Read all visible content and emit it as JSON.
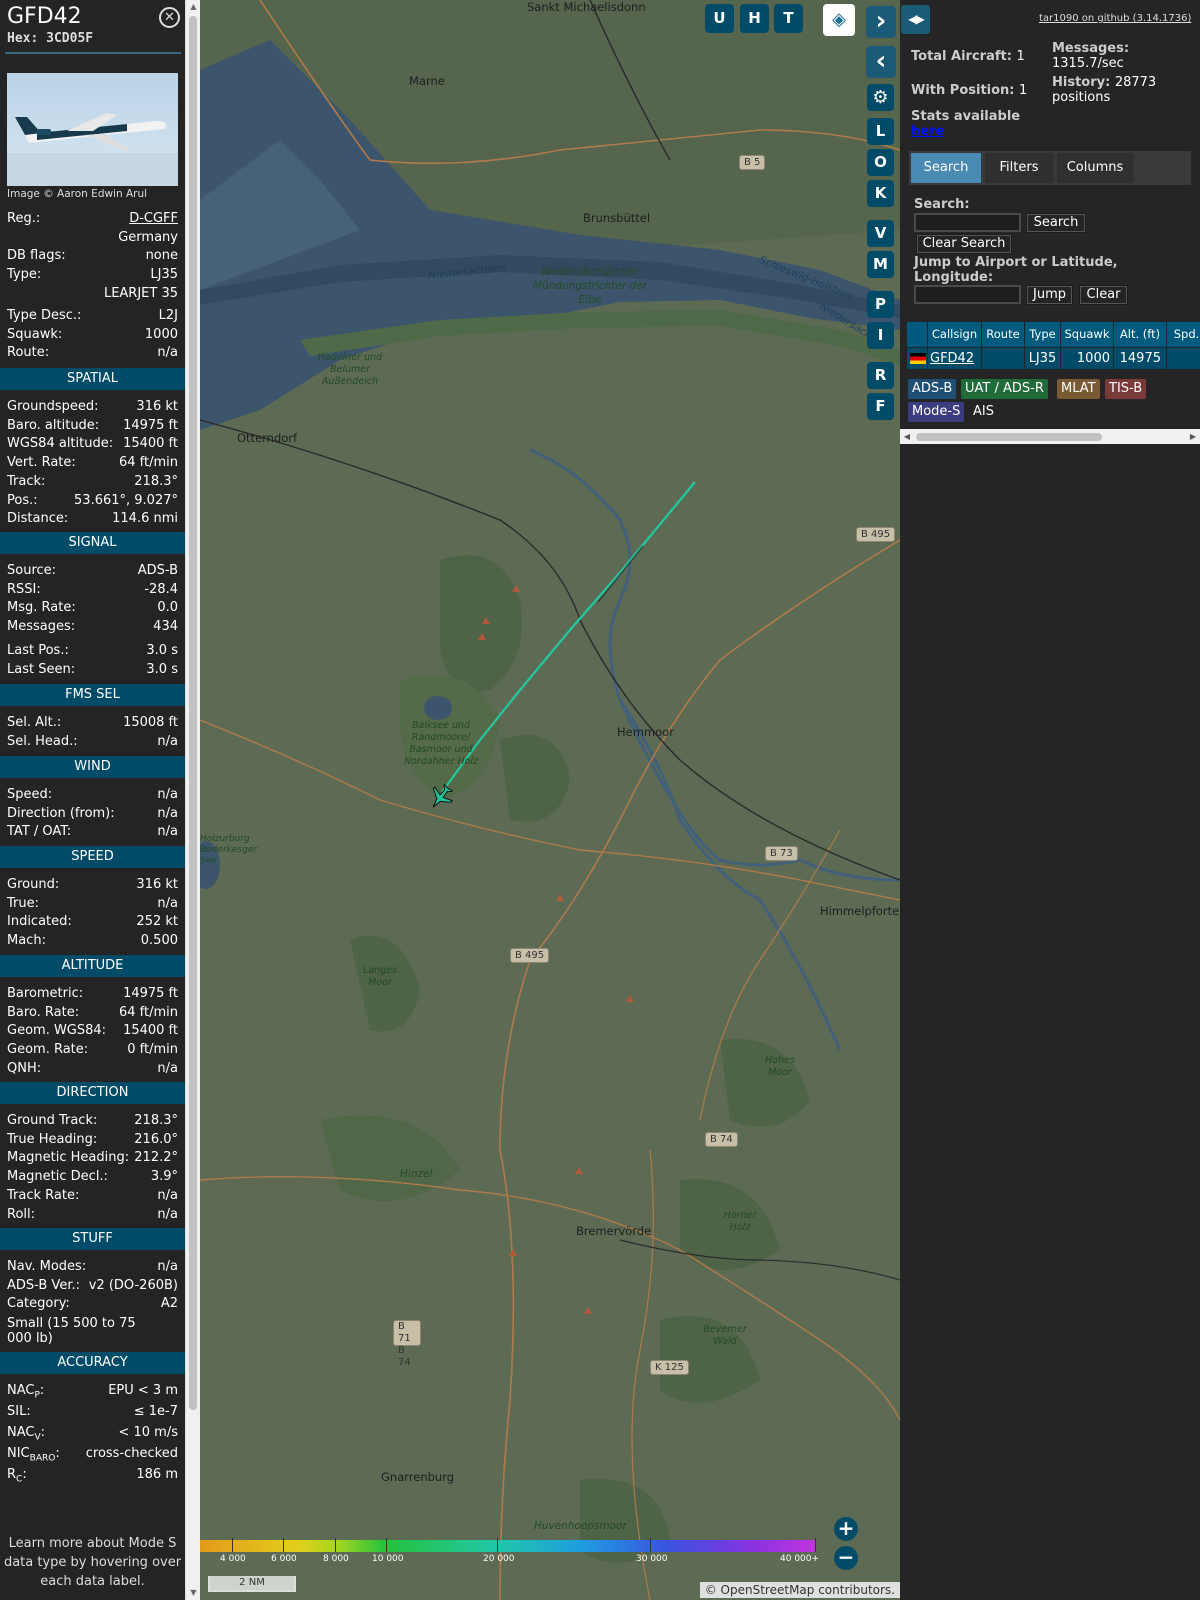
{
  "info": {
    "callsign": "GFD42",
    "hex": "Hex: 3CD05F",
    "close_icon": "close-icon",
    "photo_credit": "Image © Aaron Edwin Arul",
    "top_rows": [
      {
        "label": "Reg.:",
        "value": "D-CGFF",
        "link": true
      },
      {
        "label": "",
        "value": "Germany"
      },
      {
        "label": "DB flags:",
        "value": "none"
      },
      {
        "label": "Type:",
        "value": "LJ35"
      },
      {
        "label": "",
        "value": "LEARJET 35"
      },
      {
        "label": "Type Desc.:",
        "value": "L2J"
      },
      {
        "label": "Squawk:",
        "value": "1000"
      },
      {
        "label": "Route:",
        "value": "n/a"
      }
    ],
    "sections": [
      {
        "title": "SPATIAL",
        "rows": [
          {
            "label": "Groundspeed:",
            "value": "316 kt"
          },
          {
            "label": "Baro. altitude:",
            "value": "14975 ft"
          },
          {
            "label": "WGS84 altitude:",
            "value": "15400 ft"
          },
          {
            "label": "Vert. Rate:",
            "value": "64 ft/min"
          },
          {
            "label": "Track:",
            "value": "218.3°"
          },
          {
            "label": "Pos.:",
            "value": "53.661°, 9.027°"
          },
          {
            "label": "Distance:",
            "value": "114.6 nmi"
          }
        ]
      },
      {
        "title": "SIGNAL",
        "rows": [
          {
            "label": "Source:",
            "value": "ADS-B"
          },
          {
            "label": "RSSI:",
            "value": "-28.4"
          },
          {
            "label": "Msg. Rate:",
            "value": "0.0"
          },
          {
            "label": "Messages:",
            "value": "434"
          },
          {
            "label": "Last Pos.:",
            "value": "3.0 s"
          },
          {
            "label": "Last Seen:",
            "value": "3.0 s"
          }
        ]
      },
      {
        "title": "FMS SEL",
        "rows": [
          {
            "label": "Sel. Alt.:",
            "value": "15008 ft"
          },
          {
            "label": "Sel. Head.:",
            "value": "n/a"
          }
        ]
      },
      {
        "title": "WIND",
        "rows": [
          {
            "label": "Speed:",
            "value": "n/a"
          },
          {
            "label": "Direction (from):",
            "value": "n/a"
          },
          {
            "label": "TAT / OAT:",
            "value": "n/a"
          }
        ]
      },
      {
        "title": "SPEED",
        "rows": [
          {
            "label": "Ground:",
            "value": "316 kt"
          },
          {
            "label": "True:",
            "value": "n/a"
          },
          {
            "label": "Indicated:",
            "value": "252 kt"
          },
          {
            "label": "Mach:",
            "value": "0.500"
          }
        ]
      },
      {
        "title": "ALTITUDE",
        "rows": [
          {
            "label": "Barometric:",
            "value": "14975 ft"
          },
          {
            "label": "Baro. Rate:",
            "value": "64 ft/min"
          },
          {
            "label": "Geom. WGS84:",
            "value": "15400 ft"
          },
          {
            "label": "Geom. Rate:",
            "value": "0 ft/min"
          },
          {
            "label": "QNH:",
            "value": "n/a"
          }
        ]
      },
      {
        "title": "DIRECTION",
        "rows": [
          {
            "label": "Ground Track:",
            "value": "218.3°"
          },
          {
            "label": "True Heading:",
            "value": "216.0°"
          },
          {
            "label": "Magnetic Heading:",
            "value": "212.2°"
          },
          {
            "label": "Magnetic Decl.:",
            "value": "3.9°"
          },
          {
            "label": "Track Rate:",
            "value": "n/a"
          },
          {
            "label": "Roll:",
            "value": "n/a"
          }
        ]
      },
      {
        "title": "STUFF",
        "rows": [
          {
            "label": "Nav. Modes:",
            "value": "n/a"
          },
          {
            "label": "ADS-B Ver.:",
            "value": "v2 (DO-260B)"
          },
          {
            "label": "Category:",
            "value": "A2"
          }
        ],
        "note": "Small (15 500 to 75 000 lb)"
      },
      {
        "title": "ACCURACY",
        "rows": [
          {
            "label": "NAC",
            "sub": "P",
            "value": "EPU < 3 m"
          },
          {
            "label": "SIL:",
            "value": "≤ 1e-7"
          },
          {
            "label": "NAC",
            "sub": "V",
            "value": "< 10 m/s"
          },
          {
            "label": "NIC",
            "sub": "BARO",
            "value": "cross-checked"
          },
          {
            "label": "R",
            "sub": "C",
            "value": "186 m"
          }
        ]
      }
    ],
    "footnote": "Learn more about Mode S data type by hovering over each data label."
  },
  "map": {
    "buttons_top": [
      "U",
      "H",
      "T"
    ],
    "layers_icon": "layers-icon",
    "side_buttons": [
      {
        "label": "›",
        "name": "collapse-right-button",
        "icon": "chevron-right-icon"
      },
      {
        "label": "‹",
        "name": "collapse-left-button",
        "icon": "chevron-left-icon"
      },
      {
        "label": "⚙",
        "name": "settings-button",
        "icon": "gear-icon"
      },
      {
        "label": "L"
      },
      {
        "label": "O"
      },
      {
        "label": "K"
      },
      {
        "label": "V"
      },
      {
        "label": "M"
      },
      {
        "label": "P"
      },
      {
        "label": "I"
      },
      {
        "label": "R"
      },
      {
        "label": "F"
      }
    ],
    "towns": [
      "Sankt Michaelisdonn",
      "Marne",
      "Brunsbüttel",
      "Otterndorf",
      "Hemmoor",
      "Himmelpforten",
      "Bremervörde",
      "Gnarrenburg"
    ],
    "water_labels": [
      "Niedersachsen",
      "Schleswig-Holstein",
      "Niedersachsen"
    ],
    "nature_labels": [
      "Niedersächsischer Mündungstrichter der Elbe",
      "Hadelner und Belumer Außendeich",
      "Balksee und Randmoore/ Basmoor und Nordahner Holz",
      "Holzurburg Bederkesger See",
      "Langes Moor",
      "Hohes Moor",
      "Hinzel",
      "Horner Holz",
      "Huvenhoopsmoor",
      "Beverner Wald"
    ],
    "roads": [
      "B 5",
      "B 495",
      "B 73",
      "B 495",
      "B 74",
      "B 71 B 74",
      "K 125"
    ],
    "altitude_scale": [
      "4 000",
      "6 000",
      "8 000",
      "10 000",
      "20 000",
      "30 000",
      "40 000+"
    ],
    "scale_label": "2 NM",
    "attribution": "© OpenStreetMap contributors.",
    "zoom_in": "+",
    "zoom_out": "−"
  },
  "sidebar": {
    "toggle_icon": "expand-horizontal-icon",
    "version_link": "tar1090 on github (3.14.1736)",
    "total_aircraft_label": "Total Aircraft:",
    "total_aircraft": "1",
    "with_position_label": "With Position:",
    "with_position": "1",
    "messages_label": "Messages:",
    "messages": "1315.7/sec",
    "history_label": "History:",
    "history": "28773 positions",
    "stats_label": "Stats available",
    "stats_link": "here",
    "tabs": [
      "Search",
      "Filters",
      "Columns"
    ],
    "search_label": "Search:",
    "search_value": "",
    "search_button": "Search",
    "clear_search_button": "Clear Search",
    "jump_label": "Jump to Airport or Latitude, Longitude:",
    "jump_value": "",
    "jump_button": "Jump",
    "clear_button": "Clear",
    "table": {
      "headers": [
        "",
        "Callsign",
        "Route",
        "Type",
        "Squawk",
        "Alt. (ft)",
        "Spd."
      ],
      "rows": [
        {
          "flag": "germany-flag-icon",
          "callsign": "GFD42",
          "route": "",
          "type": "LJ35",
          "squawk": "1000",
          "alt": "14975",
          "spd": ""
        }
      ]
    },
    "source_tags": [
      {
        "label": "ADS-B",
        "color": "#1f4f75"
      },
      {
        "label": "UAT / ADS-R",
        "color": "#1f6b3a"
      },
      {
        "label": "MLAT",
        "color": "#7a5a33"
      },
      {
        "label": "TIS-B",
        "color": "#7a3a3a"
      },
      {
        "label": "Mode-S",
        "color": "#3c3c80"
      },
      {
        "label": "AIS",
        "color": "#252525"
      }
    ]
  }
}
